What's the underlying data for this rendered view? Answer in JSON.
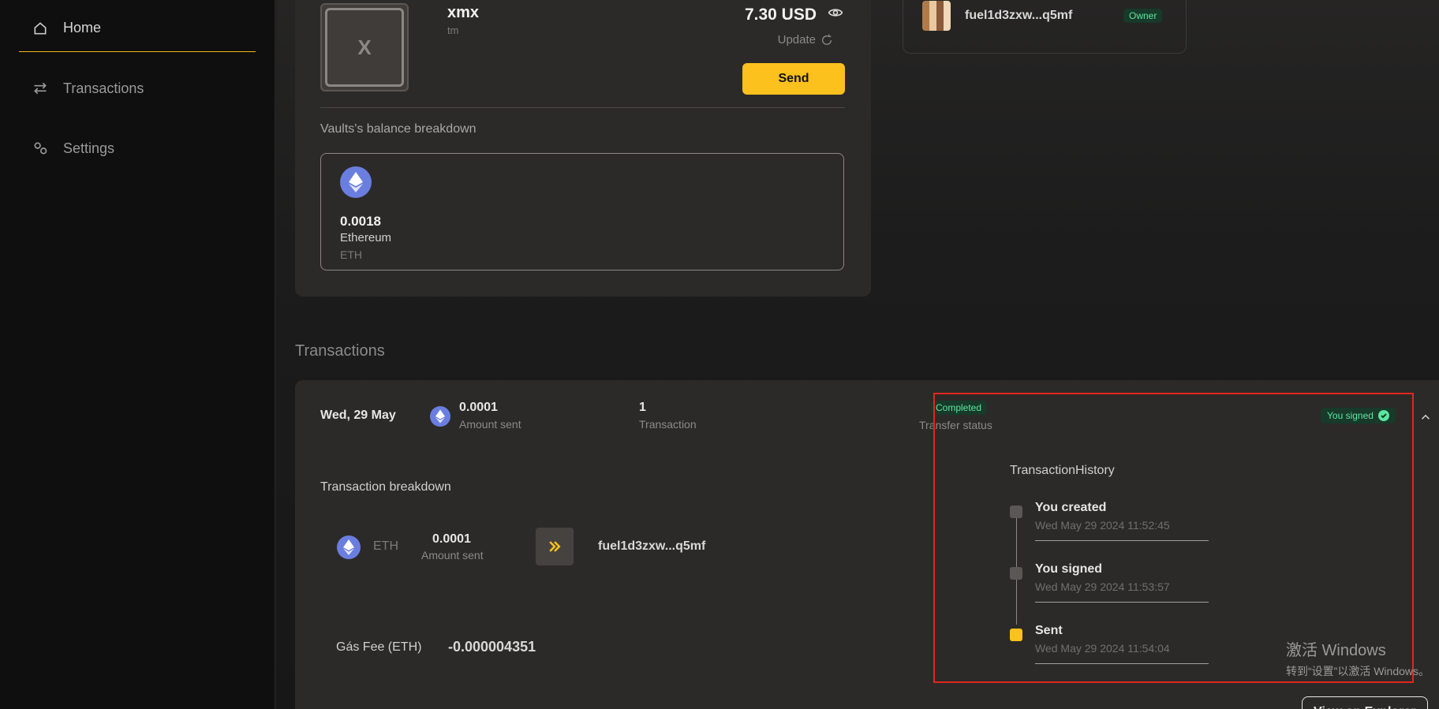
{
  "sidebar": {
    "items": [
      {
        "label": "Home",
        "icon": "home-icon",
        "active": true
      },
      {
        "label": "Transactions",
        "icon": "arrows-swap-icon",
        "active": false
      },
      {
        "label": "Settings",
        "icon": "settings-icon",
        "active": false
      }
    ]
  },
  "vault": {
    "avatar_letter": "X",
    "name": "xmx",
    "description": "tm",
    "balance": "7.30 USD",
    "update_label": "Update",
    "send_label": "Send",
    "breakdown_label": "Vaults's balance breakdown",
    "asset": {
      "amount": "0.0018",
      "name": "Ethereum",
      "symbol": "ETH"
    }
  },
  "members": {
    "address": "fuel1d3zxw...q5mf",
    "role": "Owner"
  },
  "transactions": {
    "title": "Transactions",
    "item": {
      "date": "Wed, 29 May",
      "amount": "0.0001",
      "amount_label": "Amount sent",
      "count": "1",
      "count_label": "Transaction",
      "status": "Completed",
      "status_label": "Transfer status",
      "signed_label": "You signed",
      "breakdown_title": "Transaction breakdown",
      "breakdown": {
        "symbol": "ETH",
        "amount": "0.0001",
        "amount_label": "Amount sent",
        "to": "fuel1d3zxw...q5mf"
      },
      "fee_label": "Gás Fee (ETH)",
      "fee_value": "-0.000004351",
      "history_title": "TransactionHistory",
      "history": [
        {
          "label": "You created",
          "time": "Wed May 29 2024 11:52:45"
        },
        {
          "label": "You signed",
          "time": "Wed May 29 2024 11:53:57"
        },
        {
          "label": "Sent",
          "time": "Wed May 29 2024 11:54:04"
        }
      ],
      "view_button": "View on Explorer"
    }
  },
  "watermark": {
    "line1": "激活 Windows",
    "line2": "转到“设置”以激活 Windows。"
  },
  "colors": {
    "accent": "#fcc11c",
    "success": "#5ee6a0",
    "highlight": "#e0261f"
  }
}
